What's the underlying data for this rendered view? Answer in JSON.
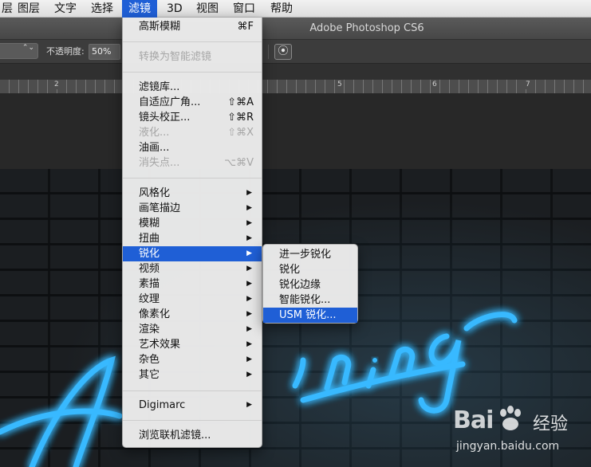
{
  "menubar": {
    "items": [
      {
        "label": "层"
      },
      {
        "label": "图层"
      },
      {
        "label": "文字"
      },
      {
        "label": "选择"
      },
      {
        "label": "滤镜"
      },
      {
        "label": "3D"
      },
      {
        "label": "视图"
      },
      {
        "label": "窗口"
      },
      {
        "label": "帮助"
      }
    ]
  },
  "titlebar": {
    "title": "Adobe Photoshop CS6"
  },
  "options": {
    "blend_arrows": "⌃⌄",
    "opacity_label": "不透明度:",
    "opacity_value": "50%",
    "airbrush_glyph": "⦿"
  },
  "ruler": {
    "numbers": [
      "2",
      "5",
      "6",
      "7"
    ]
  },
  "filter_menu": {
    "items": [
      {
        "label": "高斯模糊",
        "shortcut": "⌘F"
      },
      {
        "label": "转换为智能滤镜"
      },
      {
        "label": "滤镜库..."
      },
      {
        "label": "自适应广角...",
        "shortcut": "⇧⌘A"
      },
      {
        "label": "镜头校正...",
        "shortcut": "⇧⌘R"
      },
      {
        "label": "液化...",
        "shortcut": "⇧⌘X"
      },
      {
        "label": "油画..."
      },
      {
        "label": "消失点...",
        "shortcut": "⌥⌘V"
      },
      {
        "label": "风格化"
      },
      {
        "label": "画笔描边"
      },
      {
        "label": "模糊"
      },
      {
        "label": "扭曲"
      },
      {
        "label": "锐化"
      },
      {
        "label": "视频"
      },
      {
        "label": "素描"
      },
      {
        "label": "纹理"
      },
      {
        "label": "像素化"
      },
      {
        "label": "渲染"
      },
      {
        "label": "艺术效果"
      },
      {
        "label": "杂色"
      },
      {
        "label": "其它"
      },
      {
        "label": "Digimarc"
      },
      {
        "label": "浏览联机滤镜..."
      }
    ],
    "submenu_arrow": "▶"
  },
  "sharpen_submenu": {
    "items": [
      {
        "label": "进一步锐化"
      },
      {
        "label": "锐化"
      },
      {
        "label": "锐化边缘"
      },
      {
        "label": "智能锐化..."
      },
      {
        "label": "USM 锐化..."
      }
    ]
  },
  "watermark": {
    "brand": "Bai",
    "brand2": "经验",
    "url": "jingyan.baidu.com"
  },
  "colors": {
    "menu_highlight": "#1f5fd6",
    "neon_blue": "#37b9ff"
  }
}
